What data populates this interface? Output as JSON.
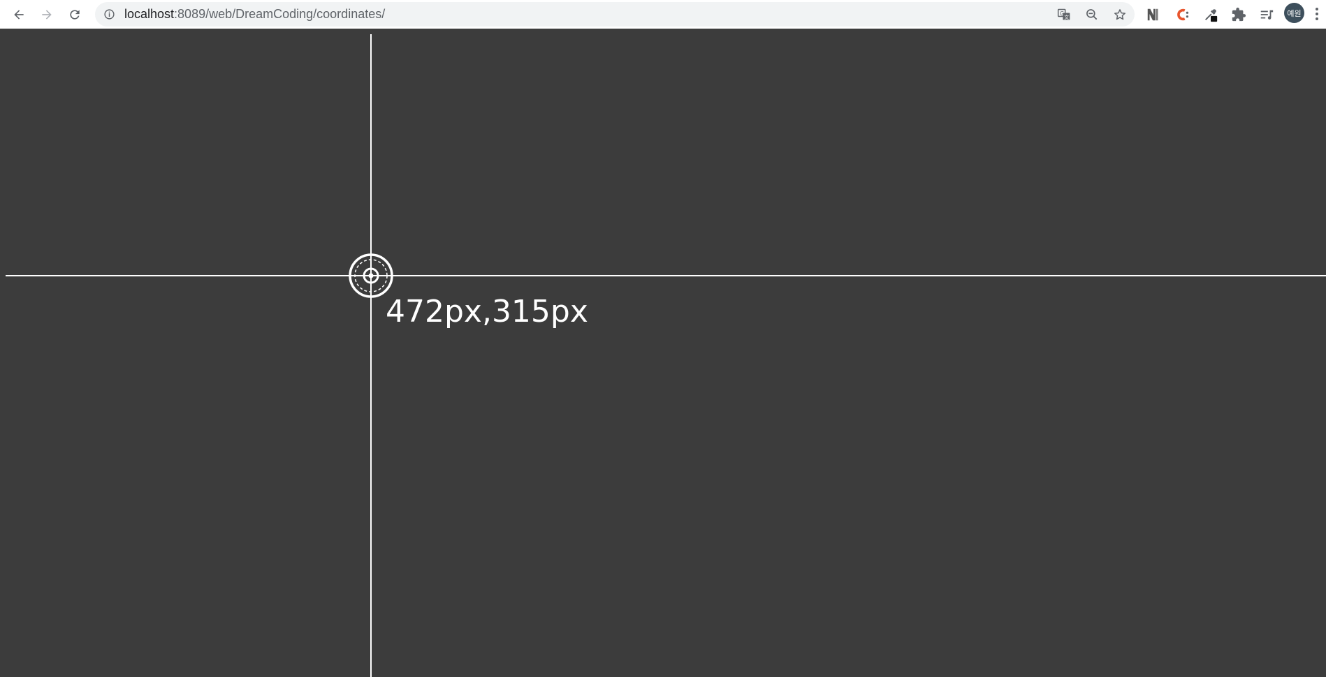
{
  "browser": {
    "url_host": "localhost",
    "url_path": ":8089/web/DreamCoding/coordinates/",
    "avatar_label": "예원",
    "icons": {
      "back": "arrow-left-icon",
      "forward": "arrow-right-icon",
      "reload": "reload-icon",
      "info": "info-icon",
      "translate": "translate-icon",
      "zoom": "zoom-out-icon",
      "bookmark": "star-icon",
      "extensions": "puzzle-icon",
      "reading_list": "reading-list-icon",
      "menu": "more-vert-icon"
    }
  },
  "page": {
    "coordinate_label": "472px,315px",
    "background_color": "#3c3c3c",
    "line_color": "#ffffff"
  }
}
